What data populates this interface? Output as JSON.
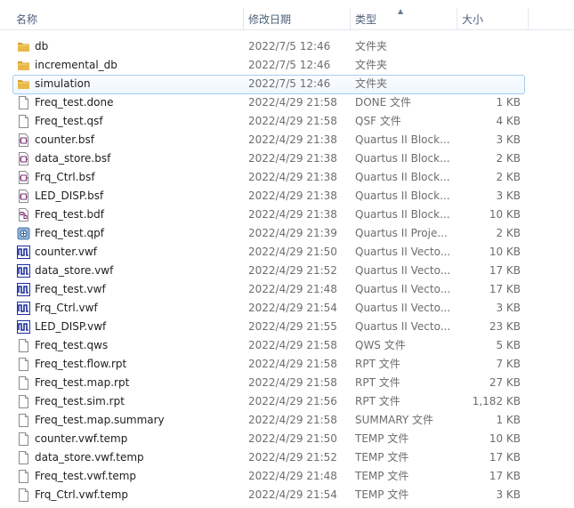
{
  "columns": {
    "name": "名称",
    "date": "修改日期",
    "type": "类型",
    "size": "大小"
  },
  "files": [
    {
      "icon": "folder-icon",
      "name": "db",
      "date": "2022/7/5 12:46",
      "type": "文件夹",
      "size": ""
    },
    {
      "icon": "folder-icon",
      "name": "incremental_db",
      "date": "2022/7/5 12:46",
      "type": "文件夹",
      "size": ""
    },
    {
      "icon": "folder-icon",
      "name": "simulation",
      "date": "2022/7/5 12:46",
      "type": "文件夹",
      "size": "",
      "selected": true
    },
    {
      "icon": "blank-file-icon",
      "name": "Freq_test.done",
      "date": "2022/4/29 21:58",
      "type": "DONE 文件",
      "size": "1 KB"
    },
    {
      "icon": "blank-file-icon",
      "name": "Freq_test.qsf",
      "date": "2022/4/29 21:58",
      "type": "QSF 文件",
      "size": "4 KB"
    },
    {
      "icon": "quartus-bsf-icon",
      "name": "counter.bsf",
      "date": "2022/4/29 21:38",
      "type": "Quartus II Block...",
      "size": "3 KB"
    },
    {
      "icon": "quartus-bsf-icon",
      "name": "data_store.bsf",
      "date": "2022/4/29 21:38",
      "type": "Quartus II Block...",
      "size": "2 KB"
    },
    {
      "icon": "quartus-bsf-icon",
      "name": "Frq_Ctrl.bsf",
      "date": "2022/4/29 21:38",
      "type": "Quartus II Block...",
      "size": "2 KB"
    },
    {
      "icon": "quartus-bsf-icon",
      "name": "LED_DISP.bsf",
      "date": "2022/4/29 21:38",
      "type": "Quartus II Block...",
      "size": "3 KB"
    },
    {
      "icon": "quartus-bdf-icon",
      "name": "Freq_test.bdf",
      "date": "2022/4/29 21:38",
      "type": "Quartus II Block...",
      "size": "10 KB"
    },
    {
      "icon": "quartus-project-icon",
      "name": "Freq_test.qpf",
      "date": "2022/4/29 21:39",
      "type": "Quartus II Proje...",
      "size": "2 KB"
    },
    {
      "icon": "waveform-icon",
      "name": "counter.vwf",
      "date": "2022/4/29 21:50",
      "type": "Quartus II Vecto...",
      "size": "10 KB"
    },
    {
      "icon": "waveform-icon",
      "name": "data_store.vwf",
      "date": "2022/4/29 21:52",
      "type": "Quartus II Vecto...",
      "size": "17 KB"
    },
    {
      "icon": "waveform-icon",
      "name": "Freq_test.vwf",
      "date": "2022/4/29 21:48",
      "type": "Quartus II Vecto...",
      "size": "17 KB"
    },
    {
      "icon": "waveform-icon",
      "name": "Frq_Ctrl.vwf",
      "date": "2022/4/29 21:54",
      "type": "Quartus II Vecto...",
      "size": "3 KB"
    },
    {
      "icon": "waveform-icon",
      "name": "LED_DISP.vwf",
      "date": "2022/4/29 21:55",
      "type": "Quartus II Vecto...",
      "size": "23 KB"
    },
    {
      "icon": "blank-file-icon",
      "name": "Freq_test.qws",
      "date": "2022/4/29 21:58",
      "type": "QWS 文件",
      "size": "5 KB"
    },
    {
      "icon": "blank-file-icon",
      "name": "Freq_test.flow.rpt",
      "date": "2022/4/29 21:58",
      "type": "RPT 文件",
      "size": "7 KB"
    },
    {
      "icon": "blank-file-icon",
      "name": "Freq_test.map.rpt",
      "date": "2022/4/29 21:58",
      "type": "RPT 文件",
      "size": "27 KB"
    },
    {
      "icon": "blank-file-icon",
      "name": "Freq_test.sim.rpt",
      "date": "2022/4/29 21:56",
      "type": "RPT 文件",
      "size": "1,182 KB"
    },
    {
      "icon": "blank-file-icon",
      "name": "Freq_test.map.summary",
      "date": "2022/4/29 21:58",
      "type": "SUMMARY 文件",
      "size": "1 KB"
    },
    {
      "icon": "blank-file-icon",
      "name": "counter.vwf.temp",
      "date": "2022/4/29 21:50",
      "type": "TEMP 文件",
      "size": "10 KB"
    },
    {
      "icon": "blank-file-icon",
      "name": "data_store.vwf.temp",
      "date": "2022/4/29 21:52",
      "type": "TEMP 文件",
      "size": "17 KB"
    },
    {
      "icon": "blank-file-icon",
      "name": "Freq_test.vwf.temp",
      "date": "2022/4/29 21:48",
      "type": "TEMP 文件",
      "size": "17 KB"
    },
    {
      "icon": "blank-file-icon",
      "name": "Frq_Ctrl.vwf.temp",
      "date": "2022/4/29 21:54",
      "type": "TEMP 文件",
      "size": "3 KB"
    }
  ],
  "colors": {
    "header_text": "#4c607a",
    "selection_border": "#a5cdf2",
    "folder": "#e8b949",
    "waveform": "#1b2fa0",
    "quartus": "#7a2d6f"
  }
}
